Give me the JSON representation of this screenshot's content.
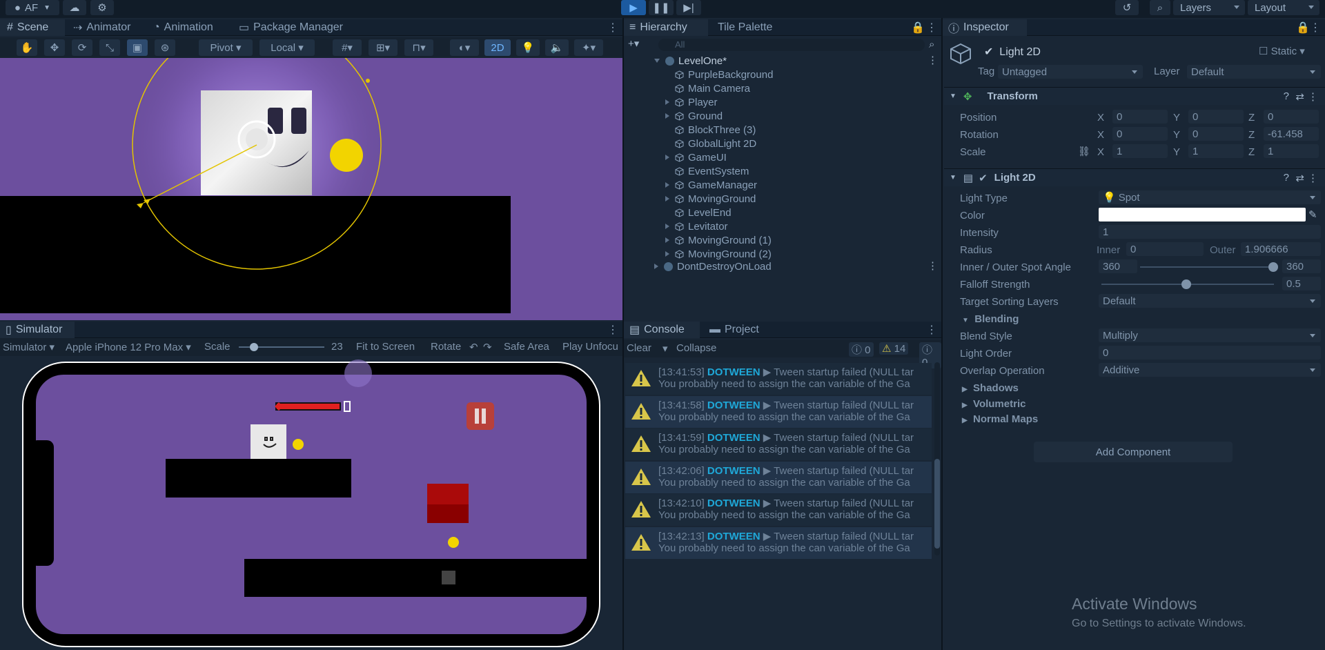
{
  "toolbar": {
    "account": "AF",
    "layers": "Layers",
    "layout": "Layout"
  },
  "scene_tabs": {
    "scene": "Scene",
    "animator": "Animator",
    "animation": "Animation",
    "package_manager": "Package Manager"
  },
  "scene_toolbar": {
    "pivot": "Pivot",
    "local": "Local",
    "mode2d": "2D"
  },
  "hierarchy": {
    "tab": "Hierarchy",
    "tile_tab": "Tile Palette",
    "search_placeholder": "All",
    "scene_name": "LevelOne*",
    "items": [
      {
        "label": "PurpleBackground",
        "expandable": false
      },
      {
        "label": "Main Camera",
        "expandable": false
      },
      {
        "label": "Player",
        "expandable": true
      },
      {
        "label": "Ground",
        "expandable": true
      },
      {
        "label": "BlockThree (3)",
        "expandable": false
      },
      {
        "label": "GlobalLight 2D",
        "expandable": false
      },
      {
        "label": "GameUI",
        "expandable": true
      },
      {
        "label": "EventSystem",
        "expandable": false
      },
      {
        "label": "GameManager",
        "expandable": true
      },
      {
        "label": "MovingGround",
        "expandable": true
      },
      {
        "label": "LevelEnd",
        "expandable": false
      },
      {
        "label": "Levitator",
        "expandable": true
      },
      {
        "label": "MovingGround (1)",
        "expandable": true
      },
      {
        "label": "MovingGround (2)",
        "expandable": true
      }
    ],
    "dont_destroy": "DontDestroyOnLoad"
  },
  "simulator": {
    "tab": "Simulator",
    "mode": "Simulator",
    "device": "Apple iPhone 12 Pro Max",
    "scale_label": "Scale",
    "scale_value": "23",
    "fit": "Fit to Screen",
    "rotate": "Rotate",
    "safe_area": "Safe Area",
    "play_unfocused": "Play Unfocu"
  },
  "console": {
    "tab": "Console",
    "project_tab": "Project",
    "clear": "Clear",
    "collapse": "Collapse",
    "count_info": "0",
    "count_warn": "14",
    "count_error": "0",
    "logs": [
      {
        "time": "[13:41:53]",
        "tag": "DOTWEEN",
        "msg": "▶ Tween startup failed (NULL tar",
        "line2": "You probably need to assign the can variable of the Ga"
      },
      {
        "time": "[13:41:58]",
        "tag": "DOTWEEN",
        "msg": "▶ Tween startup failed (NULL tar",
        "line2": "You probably need to assign the can variable of the Ga"
      },
      {
        "time": "[13:41:59]",
        "tag": "DOTWEEN",
        "msg": "▶ Tween startup failed (NULL tar",
        "line2": "You probably need to assign the can variable of the Ga"
      },
      {
        "time": "[13:42:06]",
        "tag": "DOTWEEN",
        "msg": "▶ Tween startup failed (NULL tar",
        "line2": "You probably need to assign the can variable of the Ga"
      },
      {
        "time": "[13:42:10]",
        "tag": "DOTWEEN",
        "msg": "▶ Tween startup failed (NULL tar",
        "line2": "You probably need to assign the can variable of the Ga"
      },
      {
        "time": "[13:42:13]",
        "tag": "DOTWEEN",
        "msg": "▶ Tween startup failed (NULL tar",
        "line2": "You probably need to assign the can variable of the Ga"
      }
    ]
  },
  "inspector": {
    "tab": "Inspector",
    "object_name": "Light 2D",
    "static": "Static",
    "tag_label": "Tag",
    "tag_value": "Untagged",
    "layer_label": "Layer",
    "layer_value": "Default",
    "transform": {
      "title": "Transform",
      "position_label": "Position",
      "rotation_label": "Rotation",
      "scale_label": "Scale",
      "pos": {
        "x": "0",
        "y": "0",
        "z": "0"
      },
      "rot": {
        "x": "0",
        "y": "0",
        "z": "-61.458"
      },
      "scl": {
        "x": "1",
        "y": "1",
        "z": "1"
      },
      "ax": {
        "x": "X",
        "y": "Y",
        "z": "Z"
      }
    },
    "light": {
      "title": "Light 2D",
      "light_type_label": "Light Type",
      "light_type": "Spot",
      "color_label": "Color",
      "intensity_label": "Intensity",
      "intensity": "1",
      "radius_label": "Radius",
      "inner_label": "Inner",
      "inner": "0",
      "outer_label": "Outer",
      "outer": "1.906666",
      "spot_label": "Inner / Outer Spot Angle",
      "spot_inner": "360",
      "spot_outer": "360",
      "falloff_label": "Falloff Strength",
      "falloff": "0.5",
      "sorting_label": "Target Sorting Layers",
      "sorting": "Default",
      "blending": "Blending",
      "blend_style_label": "Blend Style",
      "blend_style": "Multiply",
      "light_order_label": "Light Order",
      "light_order": "0",
      "overlap_label": "Overlap Operation",
      "overlap": "Additive",
      "shadows": "Shadows",
      "volumetric": "Volumetric",
      "normal_maps": "Normal Maps"
    },
    "add_component": "Add Component"
  },
  "watermark": {
    "title": "Activate Windows",
    "sub": "Go to Settings to activate Windows."
  },
  "colors": {
    "scene_bg": "#6c4f9e",
    "panel_bg": "#192635",
    "accent": "#2f8fd8",
    "warn": "#d8c64a",
    "health": "#e02020"
  }
}
